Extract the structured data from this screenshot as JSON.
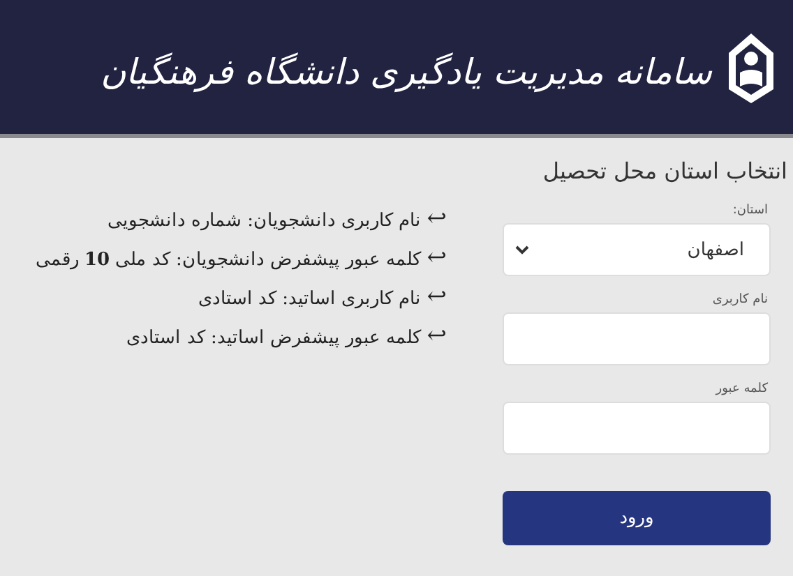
{
  "header": {
    "title": "سامانه مدیریت یادگیری دانشگاه فرهنگیان"
  },
  "form": {
    "title": "انتخاب استان محل تحصیل",
    "province": {
      "label": "استان:",
      "value": "اصفهان"
    },
    "username": {
      "label": "نام کاربری"
    },
    "password": {
      "label": "کلمه عبور"
    },
    "submit": "ورود"
  },
  "notes": [
    {
      "icon": "↩",
      "text": "نام کاربری دانشجویان: شماره دانشجویی"
    },
    {
      "icon": "↩",
      "text": "کلمه عبور پیشفرض دانشجویان: کد ملی **10** رقمی"
    },
    {
      "icon": "↩",
      "text": "نام کاربری اساتید: کد استادی"
    },
    {
      "icon": "↩",
      "text": "کلمه عبور پیشفرض اساتید: کد استادی"
    }
  ]
}
